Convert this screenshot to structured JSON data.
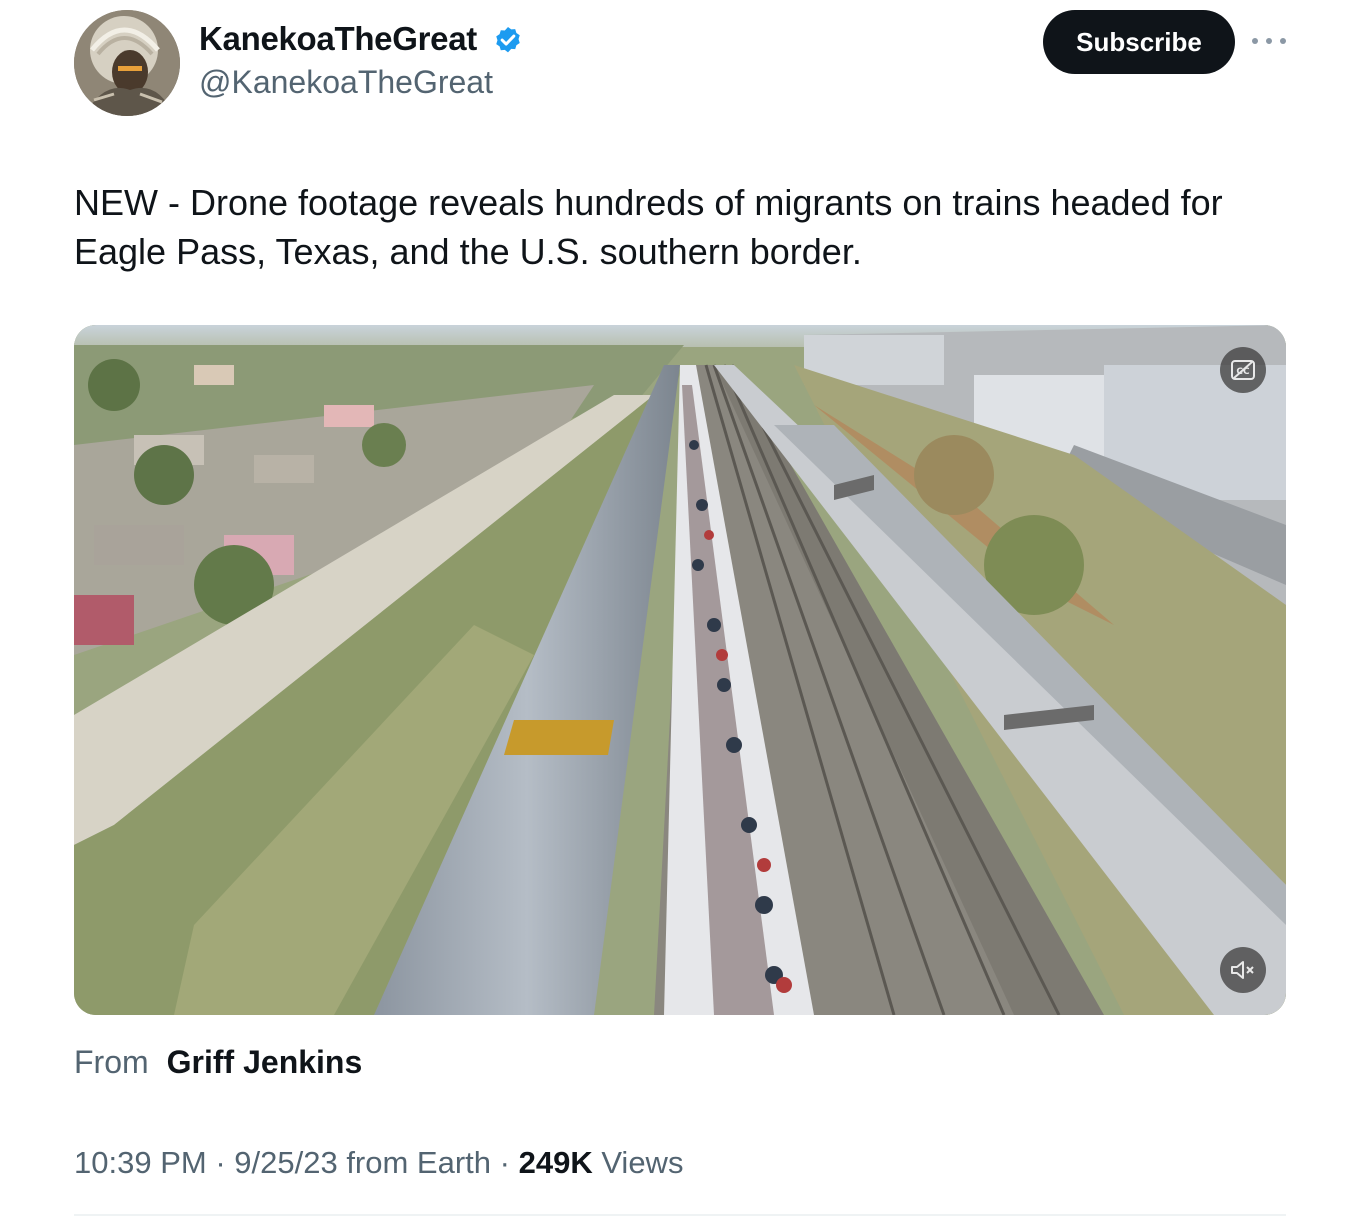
{
  "author": {
    "display_name": "KanekoaTheGreat",
    "handle": "@KanekoaTheGreat",
    "verified_icon": "verified-badge-icon",
    "avatar_icon": "avatar"
  },
  "actions": {
    "subscribe_label": "Subscribe",
    "more_icon": "more-icon"
  },
  "tweet": {
    "text": "NEW - Drone footage reveals hundreds of migrants on trains headed for Eagle Pass, Texas, and the U.S. southern border."
  },
  "media": {
    "type": "video",
    "captions_icon": "closed-captions-icon",
    "mute_icon": "speaker-muted-icon"
  },
  "attribution": {
    "from_label": "From",
    "source_name": "Griff Jenkins"
  },
  "meta": {
    "time": "10:39 PM",
    "separator1": " · ",
    "date": "9/25/23",
    "client": " from Earth",
    "separator2": " · ",
    "views_count": "249K",
    "views_label": " Views"
  },
  "colors": {
    "text_primary": "#0f1419",
    "text_secondary": "#536471",
    "verified_blue": "#1d9bf0",
    "button_dark": "#0f1419"
  }
}
